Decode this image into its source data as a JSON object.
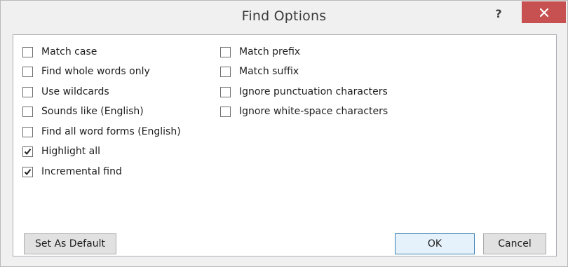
{
  "dialog": {
    "title": "Find Options",
    "help_label": "?"
  },
  "options_left": [
    {
      "label": "Match case",
      "checked": false
    },
    {
      "label": "Find whole words only",
      "checked": false
    },
    {
      "label": "Use wildcards",
      "checked": false
    },
    {
      "label": "Sounds like (English)",
      "checked": false
    },
    {
      "label": "Find all word forms (English)",
      "checked": false
    },
    {
      "label": "Highlight all",
      "checked": true
    },
    {
      "label": "Incremental find",
      "checked": true
    }
  ],
  "options_right": [
    {
      "label": "Match prefix",
      "checked": false
    },
    {
      "label": "Match suffix",
      "checked": false
    },
    {
      "label": "Ignore punctuation characters",
      "checked": false
    },
    {
      "label": "Ignore white-space characters",
      "checked": false
    }
  ],
  "buttons": {
    "set_default": "Set As Default",
    "ok": "OK",
    "cancel": "Cancel"
  },
  "icons": {
    "close": "close-icon",
    "check": "checkmark-icon"
  },
  "colors": {
    "close_bg": "#c75050",
    "dialog_bg": "#f0f0f0",
    "content_bg": "#ffffff",
    "default_btn_border": "#3c7fb1"
  }
}
